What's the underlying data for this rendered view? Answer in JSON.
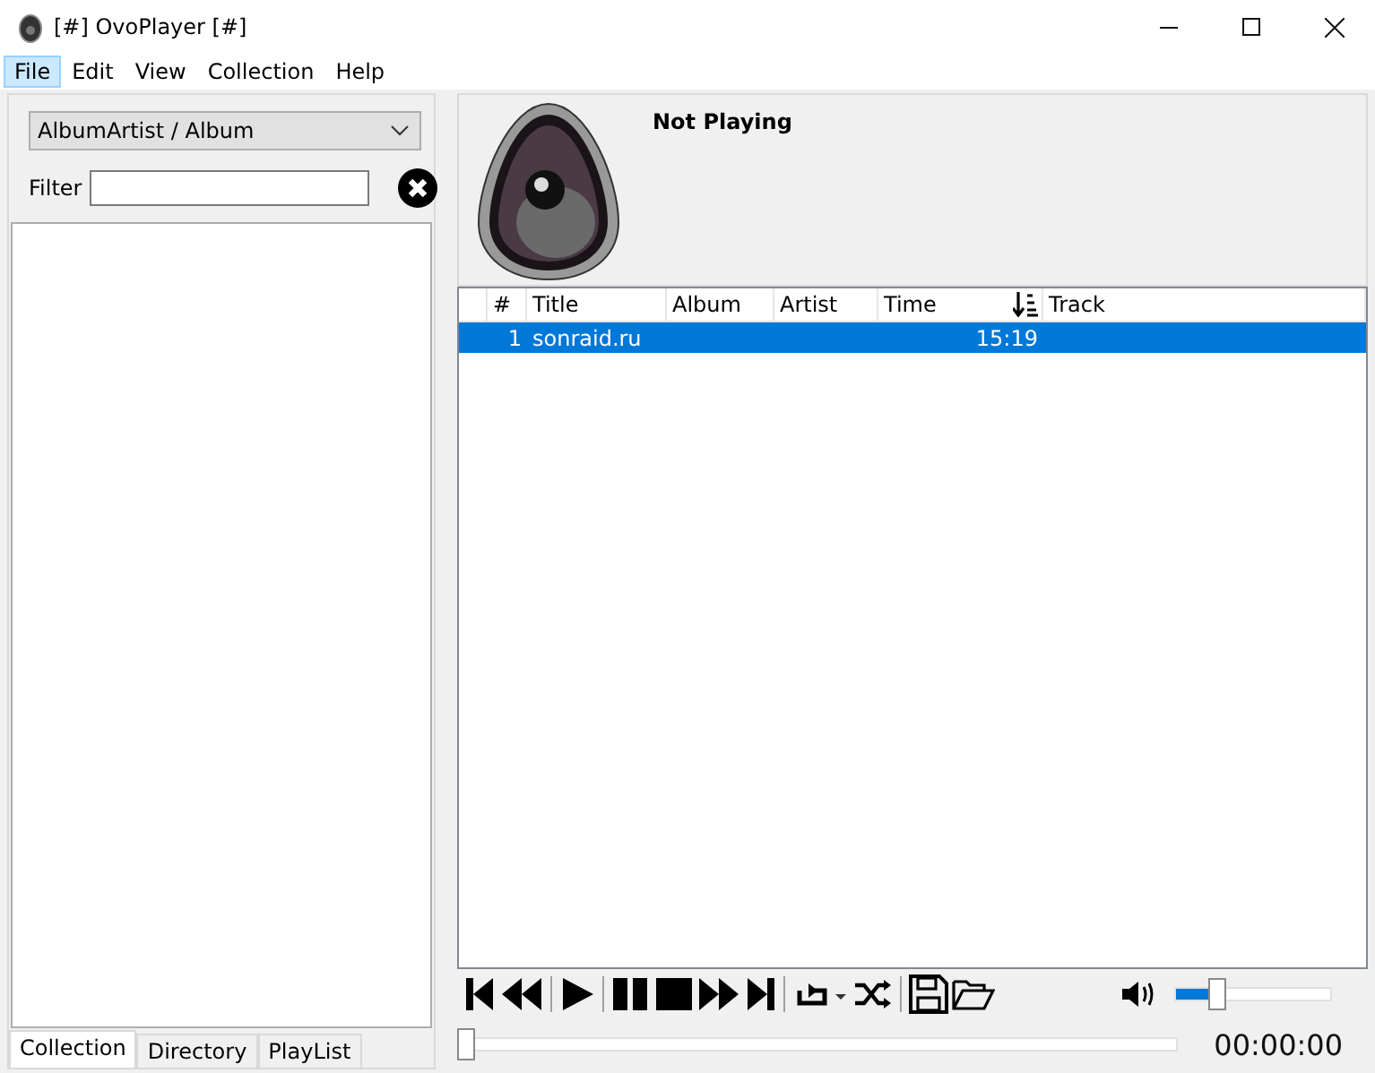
{
  "window": {
    "title": "[#] OvoPlayer [#]"
  },
  "menu": [
    {
      "label": "File",
      "selected": true
    },
    {
      "label": "Edit",
      "selected": false
    },
    {
      "label": "View",
      "selected": false
    },
    {
      "label": "Collection",
      "selected": false
    },
    {
      "label": "Help",
      "selected": false
    }
  ],
  "collection": {
    "grouping": "AlbumArtist / Album",
    "filter_label": "Filter"
  },
  "tabs": [
    {
      "label": "Collection",
      "selected": true
    },
    {
      "label": "Directory",
      "selected": false
    },
    {
      "label": "PlayList",
      "selected": false
    }
  ],
  "now_playing": "Not Playing",
  "playlist": {
    "columns": [
      "#",
      "Title",
      "Album",
      "Artist",
      "Time",
      "Track"
    ],
    "rows": [
      {
        "number": "1",
        "title": "sonraid.ru",
        "time": "15:19",
        "selected": true
      }
    ]
  },
  "volume": {
    "level": 0.28
  },
  "seek": {
    "level": 0
  },
  "time": "00:00:00"
}
